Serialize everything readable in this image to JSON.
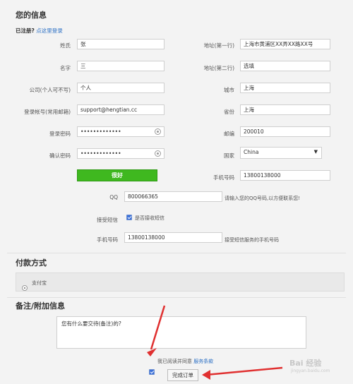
{
  "section_info": {
    "title": "您的信息"
  },
  "registered": {
    "prefix": "已注册?",
    "link": "点这里登录"
  },
  "left_fields": [
    {
      "label": "姓氏",
      "value": "张"
    },
    {
      "label": "名字",
      "value": "三"
    },
    {
      "label": "公司(个人可不写)",
      "value": "个人"
    },
    {
      "label": "登录帐号(常用邮箱)",
      "value": "support@hengtian.cc"
    },
    {
      "label": "登录密码",
      "value": "•••••••••••••"
    },
    {
      "label": "确认密码",
      "value": "•••••••••••••"
    }
  ],
  "right_fields": [
    {
      "label": "地址(第一行)",
      "value": "上海市黄浦区XX弄XX路XX号"
    },
    {
      "label": "地址(第二行)",
      "value": "选填"
    },
    {
      "label": "城市",
      "value": "上海"
    },
    {
      "label": "省份",
      "value": "上海"
    },
    {
      "label": "邮编",
      "value": "200010"
    },
    {
      "label": "国家",
      "value": "China"
    },
    {
      "label": "手机号码",
      "value": "13800138000"
    }
  ],
  "strength_button": {
    "label": "很好"
  },
  "qq": {
    "label": "QQ",
    "value": "800066365",
    "hint": "请输入您的QQ号码,以方便联系您!"
  },
  "sms": {
    "label": "接受短信",
    "checkbox_label": "是否接收短信"
  },
  "mobile2": {
    "label": "手机号码",
    "value": "13800138000",
    "hint": "接受短信服务的手机号码"
  },
  "payment": {
    "title": "付款方式",
    "option": "支付宝"
  },
  "notes": {
    "title": "备注/附加信息",
    "value": "您有什么要交待(备注)的?"
  },
  "agree": {
    "text": "我已阅读并同意",
    "link": "服务条款"
  },
  "submit": {
    "label": "完成订单"
  },
  "watermark": {
    "text": "Bai 经验",
    "sub": "jingyan.baidu.com"
  },
  "colors": {
    "arrow": "#e03030",
    "green": "#3fb81f",
    "link": "#2b6fc4"
  }
}
